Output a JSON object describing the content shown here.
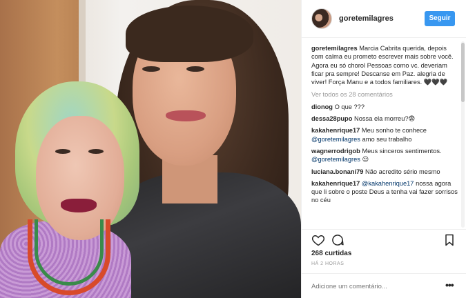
{
  "header": {
    "username": "goretemilagres",
    "follow_label": "Seguir"
  },
  "caption": {
    "username": "goretemilagres",
    "text": "Marcia Cabrita querida, depois com calma eu prometo escrever mais sobre você. Agora eu só chorol Pessoas como vc. deveriam ficar pra sempre! Descanse em Paz. alegria de viver! Força Manu e a todos familiares. 🖤🖤🖤"
  },
  "view_all_label": "Ver todos os 28 comentários",
  "comments": [
    {
      "user": "dionog",
      "text": "O que ???"
    },
    {
      "user": "dessa28pupo",
      "text": "Nossa ela morreu?😨"
    },
    {
      "user": "kakahenrique17",
      "text": "Meu sonho te conhece",
      "mention": "@goretemilagres",
      "after": "amo seu trabalho"
    },
    {
      "user": "wagnerrodrigob",
      "text": "Meus sinceros sentimentos.",
      "mention": "@goretemilagres",
      "after": "😔"
    },
    {
      "user": "luciana.bonani79",
      "text": "Não acredito sério mesmo"
    },
    {
      "user": "kakahenrique17",
      "text": "",
      "mention": "@kakahenrique17",
      "after": "nossa agora que li sobre o poste Deus a tenha vai fazer sorrisos no céu"
    }
  ],
  "likes_label": "268 curtidas",
  "time_label": "HÁ 2 HORAS",
  "add_comment_placeholder": "Adicione um comentário...",
  "more_label": "•••",
  "icons": [
    "heart-icon",
    "comment-icon",
    "bookmark-icon",
    "more-options-icon"
  ],
  "colors": {
    "follow_button": "#3897f0",
    "mention": "#003569",
    "muted": "#999999"
  }
}
